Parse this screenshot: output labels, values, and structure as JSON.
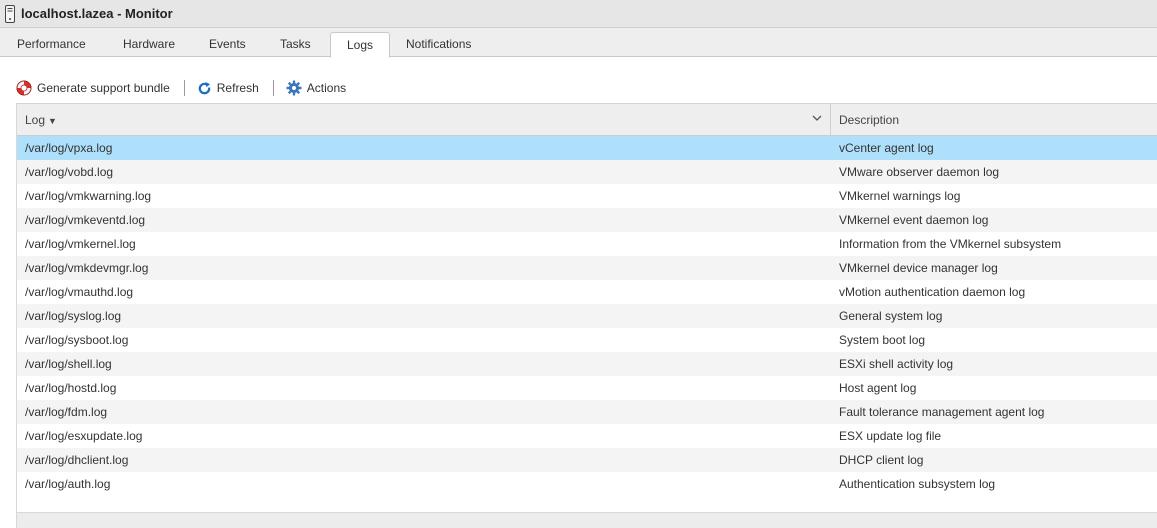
{
  "window": {
    "title": "localhost.lazea - Monitor"
  },
  "tabs": [
    {
      "label": "Performance"
    },
    {
      "label": "Hardware"
    },
    {
      "label": "Events"
    },
    {
      "label": "Tasks"
    },
    {
      "label": "Logs",
      "active": true
    },
    {
      "label": "Notifications"
    }
  ],
  "toolbar": {
    "support_label": "Generate support bundle",
    "refresh_label": "Refresh",
    "actions_label": "Actions"
  },
  "grid": {
    "columns": {
      "log": "Log",
      "description": "Description"
    },
    "rows": [
      {
        "log": "/var/log/vpxa.log",
        "description": "vCenter agent log",
        "selected": true
      },
      {
        "log": "/var/log/vobd.log",
        "description": "VMware observer daemon log"
      },
      {
        "log": "/var/log/vmkwarning.log",
        "description": "VMkernel warnings log"
      },
      {
        "log": "/var/log/vmkeventd.log",
        "description": "VMkernel event daemon log"
      },
      {
        "log": "/var/log/vmkernel.log",
        "description": "Information from the VMkernel subsystem"
      },
      {
        "log": "/var/log/vmkdevmgr.log",
        "description": "VMkernel device manager log"
      },
      {
        "log": "/var/log/vmauthd.log",
        "description": "vMotion authentication daemon log"
      },
      {
        "log": "/var/log/syslog.log",
        "description": "General system log"
      },
      {
        "log": "/var/log/sysboot.log",
        "description": "System boot log"
      },
      {
        "log": "/var/log/shell.log",
        "description": "ESXi shell activity log"
      },
      {
        "log": "/var/log/hostd.log",
        "description": "Host agent log"
      },
      {
        "log": "/var/log/fdm.log",
        "description": "Fault tolerance management agent log"
      },
      {
        "log": "/var/log/esxupdate.log",
        "description": "ESX update log file"
      },
      {
        "log": "/var/log/dhclient.log",
        "description": "DHCP client log"
      },
      {
        "log": "/var/log/auth.log",
        "description": "Authentication subsystem log"
      }
    ]
  },
  "colors": {
    "selected_row": "#aee0fb",
    "refresh_icon": "#1b6fc2",
    "actions_icon": "#3c75b8",
    "support_icon": "#d9302c"
  }
}
